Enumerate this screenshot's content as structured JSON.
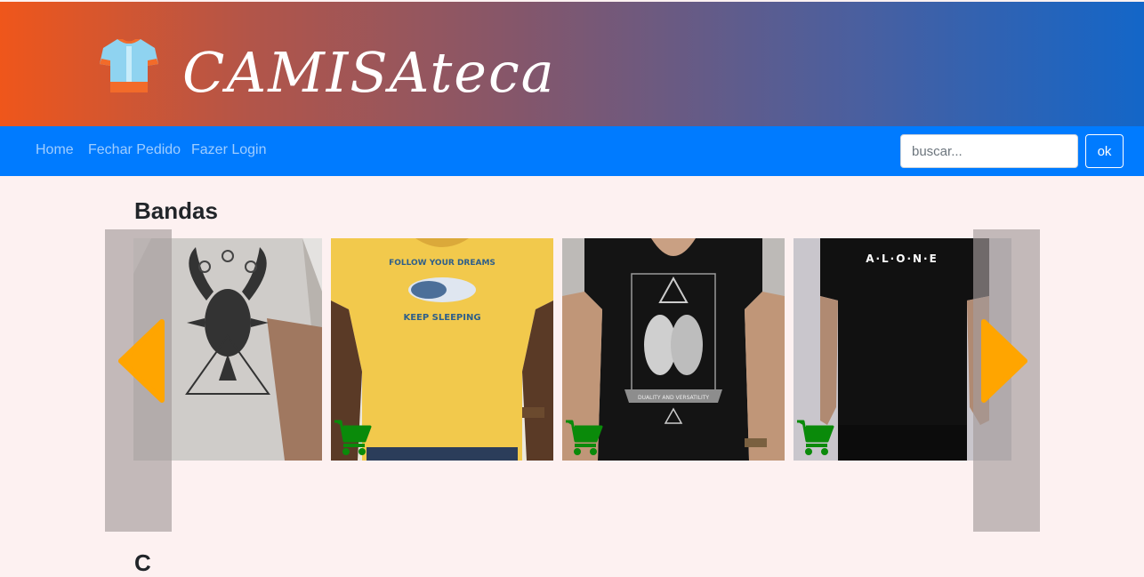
{
  "brand": {
    "name": "CAMISAteca",
    "logo_icon": "tshirt-icon"
  },
  "nav": {
    "items": [
      {
        "label": "Home"
      },
      {
        "label": "Fechar Pedido"
      },
      {
        "label": "Fazer Login"
      }
    ]
  },
  "search": {
    "placeholder": "buscar...",
    "button_label": "ok"
  },
  "sections": [
    {
      "title": "Bandas"
    },
    {
      "title": "C"
    }
  ],
  "products": [
    {
      "print": "goat illustration",
      "shirt_color": "#d9d6d3",
      "cart_icon": "cart-icon"
    },
    {
      "print": "FOLLOW YOUR DREAMS / KEEP SLEEPING",
      "shirt_color": "#f3c84b",
      "cart_icon": "cart-icon"
    },
    {
      "print": "gemini illustration",
      "shirt_color": "#141414",
      "cart_icon": "cart-icon"
    },
    {
      "print": "A . L . O . N . E",
      "shirt_color": "#111111",
      "cart_icon": "cart-icon"
    }
  ],
  "product_texts": {
    "dreams_top": "FOLLOW YOUR DREAMS",
    "dreams_bottom": "KEEP SLEEPING",
    "alone": "A·L·O·N·E",
    "gemini_ribbon": "DUALITY AND VERSATILITY"
  },
  "colors": {
    "nav_bg": "#007bff",
    "arrow": "#ffa500",
    "cart": "#0a8a0a",
    "page_bg": "#fdf1f1"
  }
}
